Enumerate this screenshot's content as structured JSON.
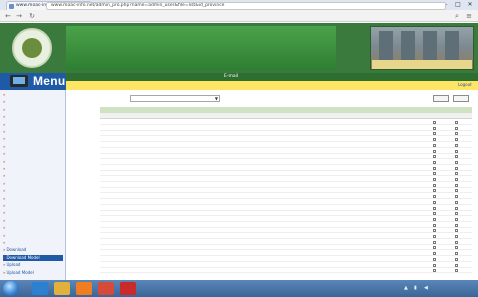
{
  "browser": {
    "tab_title": "www.moac-info.net",
    "address": "www.moac-info.net/admin_pro.php?name=admin_user&file=list&id_province",
    "window_controls": [
      "–",
      "□",
      "✕"
    ]
  },
  "site": {
    "header_title_1": "",
    "header_title_2": "",
    "photo_caption": ""
  },
  "menu": {
    "label": "Menu"
  },
  "topnav": {
    "items": [
      "",
      "",
      "",
      "",
      "",
      "",
      "E-mail",
      ""
    ]
  },
  "logout_label": "Logout",
  "sidebar": {
    "items": [
      "",
      "",
      "",
      "",
      "",
      "",
      "",
      "",
      "",
      "",
      "",
      "",
      "",
      "",
      "",
      "",
      "",
      "",
      "",
      "",
      "",
      "Download",
      "Download Model",
      "Upload",
      "Upload Model"
    ]
  },
  "filter": {
    "label": "",
    "selected_value": "",
    "search_button": "",
    "add_button": ""
  },
  "table": {
    "section_title": "",
    "headers": [
      "",
      "",
      "",
      "",
      "",
      ""
    ],
    "rows": [
      {
        "c1": "",
        "c2": "",
        "c3": ""
      },
      {
        "c1": "",
        "c2": "",
        "c3": ""
      },
      {
        "c1": "",
        "c2": "",
        "c3": ""
      },
      {
        "c1": "",
        "c2": "",
        "c3": ""
      },
      {
        "c1": "",
        "c2": "",
        "c3": ""
      },
      {
        "c1": "",
        "c2": "",
        "c3": ""
      },
      {
        "c1": "",
        "c2": "",
        "c3": ""
      },
      {
        "c1": "",
        "c2": "",
        "c3": ""
      },
      {
        "c1": "",
        "c2": "",
        "c3": ""
      },
      {
        "c1": "",
        "c2": "",
        "c3": ""
      },
      {
        "c1": "",
        "c2": "",
        "c3": ""
      },
      {
        "c1": "",
        "c2": "",
        "c3": ""
      },
      {
        "c1": "",
        "c2": "",
        "c3": ""
      },
      {
        "c1": "",
        "c2": "",
        "c3": ""
      },
      {
        "c1": "",
        "c2": "",
        "c3": ""
      },
      {
        "c1": "",
        "c2": "",
        "c3": ""
      },
      {
        "c1": "",
        "c2": "",
        "c3": ""
      },
      {
        "c1": "",
        "c2": "",
        "c3": ""
      },
      {
        "c1": "",
        "c2": "",
        "c3": ""
      },
      {
        "c1": "",
        "c2": "",
        "c3": ""
      },
      {
        "c1": "",
        "c2": "",
        "c3": ""
      },
      {
        "c1": "",
        "c2": "",
        "c3": ""
      },
      {
        "c1": "",
        "c2": "",
        "c3": ""
      },
      {
        "c1": "",
        "c2": "",
        "c3": ""
      },
      {
        "c1": "",
        "c2": "",
        "c3": ""
      },
      {
        "c1": "",
        "c2": "",
        "c3": ""
      },
      {
        "c1": "",
        "c2": "",
        "c3": ""
      }
    ]
  },
  "taskbar": {
    "apps": [
      "ie-icon",
      "folder-icon",
      "media-player-icon",
      "chrome-icon",
      "pdf-icon"
    ],
    "time": "",
    "date": ""
  },
  "colors": {
    "header_green": "#3a7a3c",
    "menu_blue": "#1e5aa6",
    "nav_yellow": "#ffe566",
    "link_blue": "#2b55a0"
  }
}
